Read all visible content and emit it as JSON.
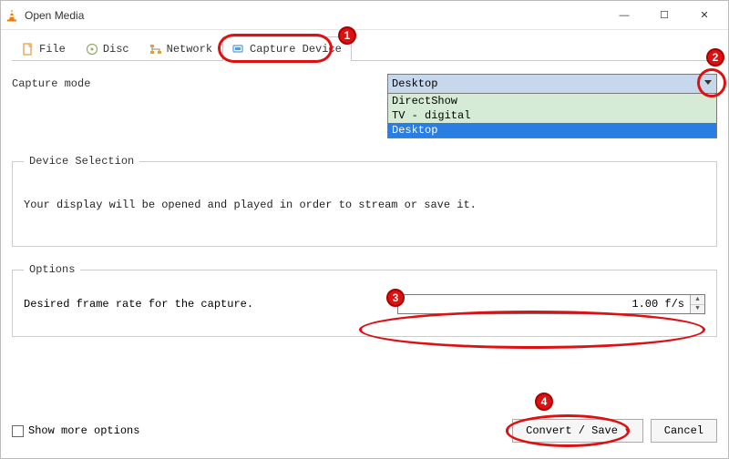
{
  "window": {
    "title": "Open Media"
  },
  "tabs": {
    "file": {
      "label": "File"
    },
    "disc": {
      "label": "Disc"
    },
    "network": {
      "label": "Network"
    },
    "capture": {
      "label": "Capture Device"
    }
  },
  "capture": {
    "mode_label": "Capture mode",
    "selected": "Desktop",
    "options": {
      "0": "DirectShow",
      "1": "TV - digital",
      "2": "Desktop"
    }
  },
  "device": {
    "legend": "Device Selection",
    "desc": "Your display will be opened and played in order to stream or save it."
  },
  "options": {
    "legend": "Options",
    "fps_label": "Desired frame rate for the capture.",
    "fps_value": "1.00 f/s"
  },
  "footer": {
    "show_more": "Show more options",
    "convert": "Convert / Save",
    "cancel": "Cancel"
  },
  "badges": {
    "b1": "1",
    "b2": "2",
    "b3": "3",
    "b4": "4"
  }
}
